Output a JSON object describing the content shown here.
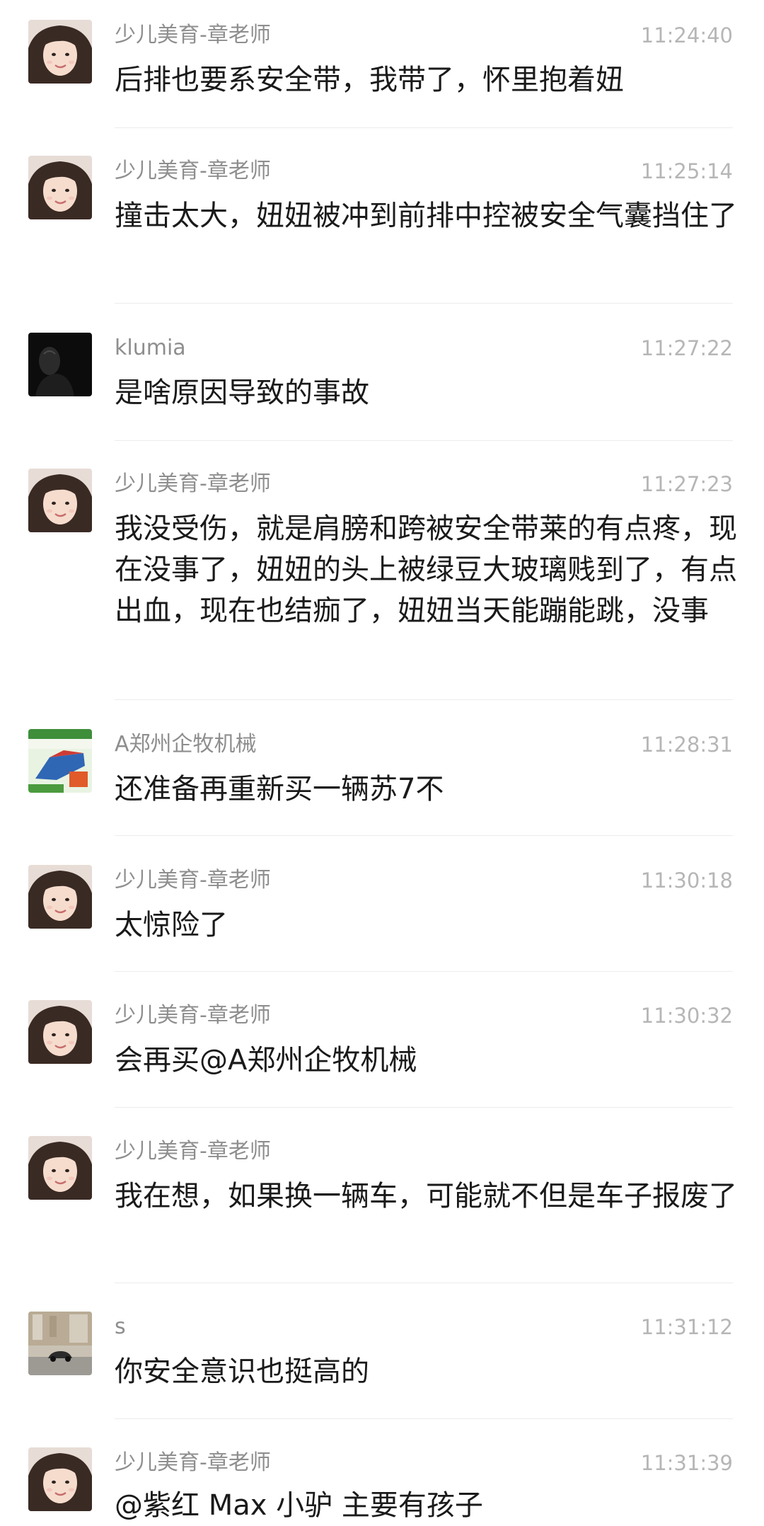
{
  "messages": [
    {
      "sender": "少儿美育-章老师",
      "time": "11:24:40",
      "text": "后排也要系安全带，我带了，怀里抱着妞",
      "avatar": "girl-avatar"
    },
    {
      "sender": "少儿美育-章老师",
      "time": "11:25:14",
      "text": "撞击太大，妞妞被冲到前排中控被安全气囊挡住了",
      "avatar": "girl-avatar"
    },
    {
      "sender": "klumia",
      "time": "11:27:22",
      "text": "是啥原因导致的事故",
      "avatar": "dark-avatar"
    },
    {
      "sender": "少儿美育-章老师",
      "time": "11:27:23",
      "text": "我没受伤，就是肩膀和跨被安全带莱的有点疼，现在没事了，妞妞的头上被绿豆大玻璃贱到了，有点出血，现在也结痂了，妞妞当天能蹦能跳，没事",
      "avatar": "girl-avatar"
    },
    {
      "sender": "A郑州企牧机械",
      "time": "11:28:31",
      "text": "还准备再重新买一辆苏7不",
      "avatar": "machine-avatar"
    },
    {
      "sender": "少儿美育-章老师",
      "time": "11:30:18",
      "text": "太惊险了",
      "avatar": "girl-avatar"
    },
    {
      "sender": "少儿美育-章老师",
      "time": "11:30:32",
      "text": "会再买@A郑州企牧机械",
      "avatar": "girl-avatar"
    },
    {
      "sender": "少儿美育-章老师",
      "time": "",
      "text": "我在想，如果换一辆车，可能就不但是车子报废了",
      "avatar": "girl-avatar"
    },
    {
      "sender": "s",
      "time": "11:31:12",
      "text": "你安全意识也挺高的",
      "avatar": "street-avatar"
    },
    {
      "sender": "少儿美育-章老师",
      "time": "11:31:39",
      "text": "@紫红 Max 小驴 主要有孩子",
      "avatar": "girl-avatar"
    }
  ],
  "colors": {
    "background": "#ffffff",
    "name": "#8e8e8e",
    "time": "#b6b6b6",
    "text": "#1a1a1a",
    "divider": "#ececec"
  }
}
